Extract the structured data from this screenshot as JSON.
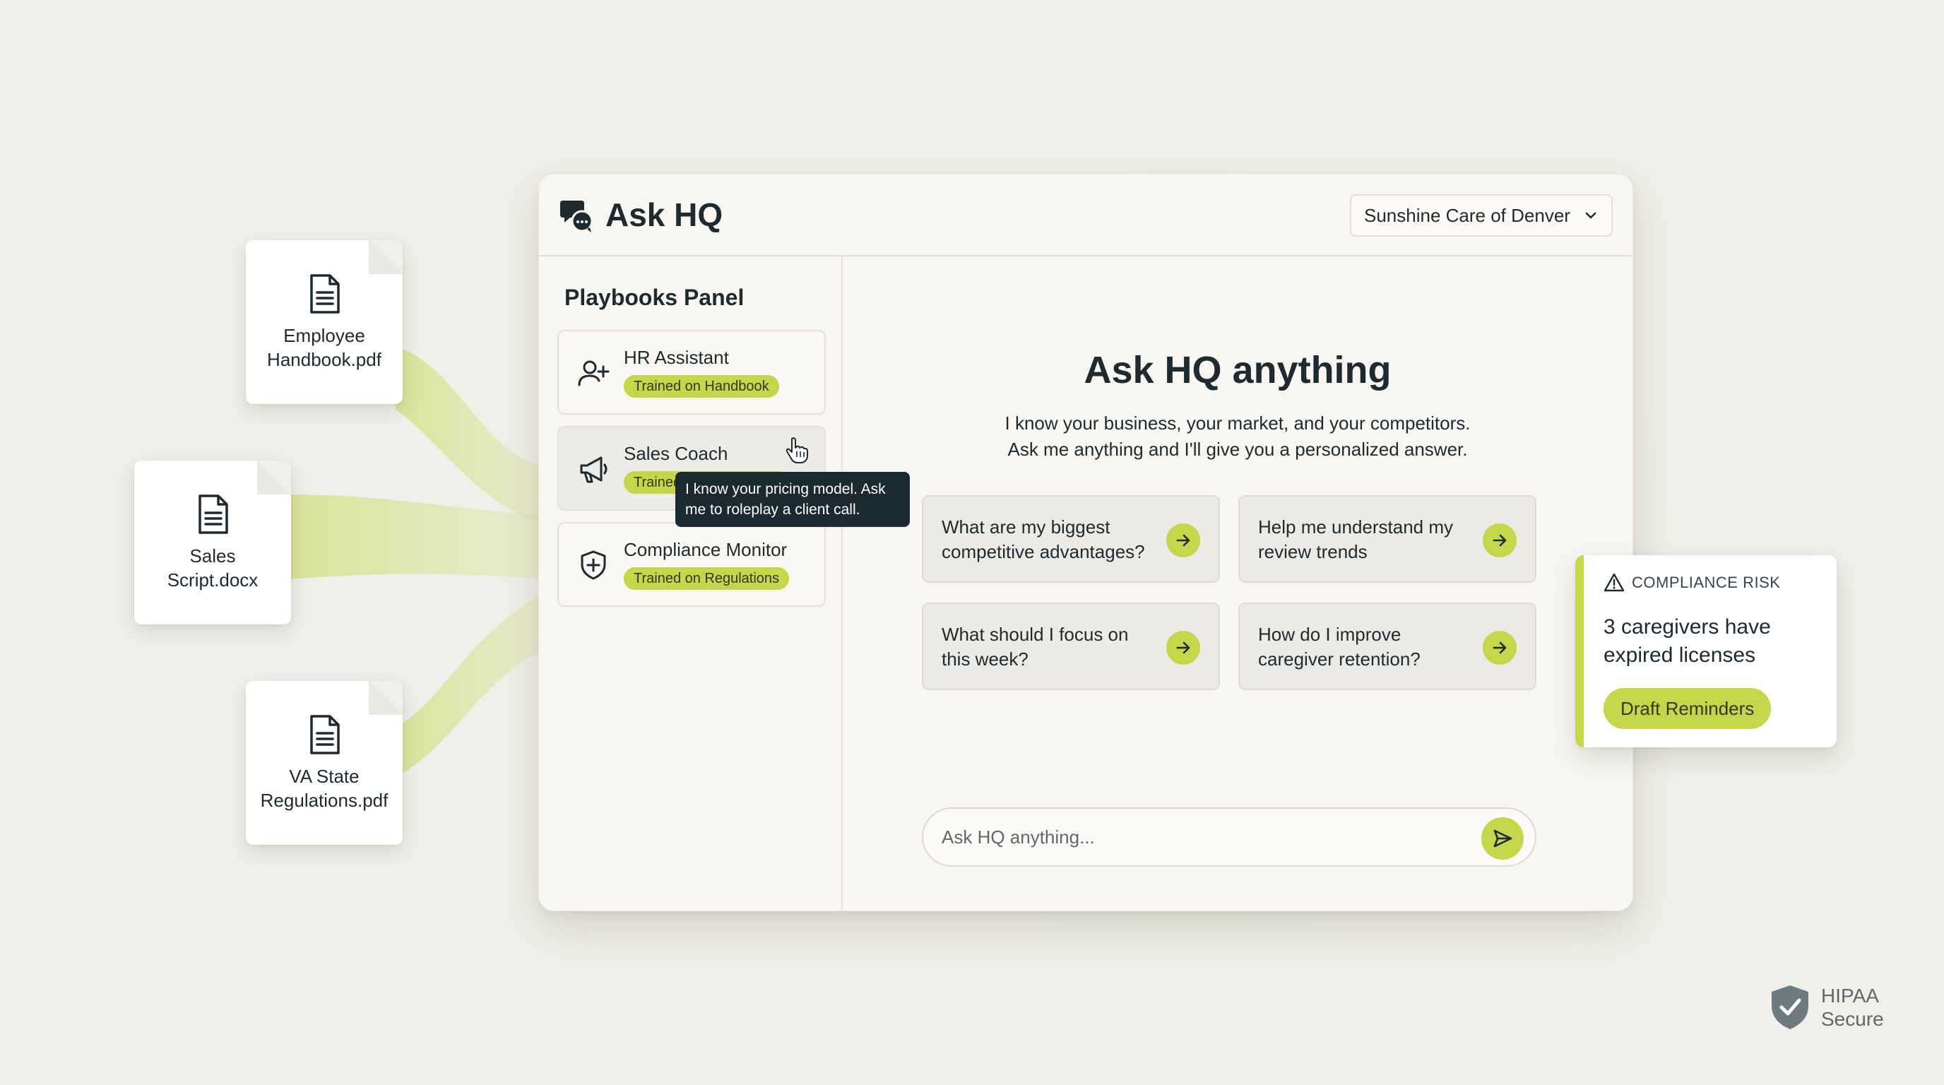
{
  "colors": {
    "accent_lime": "#c5d64b",
    "ink": "#1d2a30",
    "background": "#f0efe9",
    "tooltip_bg": "#1a2a30"
  },
  "documents": [
    {
      "name": "Employee\nHandbook.pdf",
      "icon": "document-icon"
    },
    {
      "name": "Sales\nScript.docx",
      "icon": "document-icon"
    },
    {
      "name": "VA State\nRegulations.pdf",
      "icon": "document-icon"
    }
  ],
  "header": {
    "logo_icon": "chat-bubbles-icon",
    "title": "Ask HQ",
    "location_select": {
      "value": "Sunshine Care of Denver",
      "icon": "chevron-down-icon"
    }
  },
  "sidebar": {
    "title": "Playbooks Panel",
    "playbooks": [
      {
        "name": "HR Assistant",
        "badge": "Trained on Handbook",
        "icon": "user-plus-icon"
      },
      {
        "name": "Sales Coach",
        "badge": "Trained on Sales Script",
        "icon": "megaphone-icon",
        "hovered": true
      },
      {
        "name": "Compliance Monitor",
        "badge": "Trained on Regulations",
        "icon": "shield-plus-icon"
      }
    ],
    "tooltip": {
      "line1": "I know your pricing model. Ask",
      "line2": "me to roleplay a client call."
    },
    "cursor_icon": "hand-pointer-icon"
  },
  "main": {
    "title": "Ask HQ anything",
    "subtitle_line1": "I know your business, your market, and your competitors.",
    "subtitle_line2": "Ask me anything and I'll give you a personalized answer.",
    "prompts": [
      {
        "line1": "What are my biggest",
        "line2": "competitive advantages?"
      },
      {
        "line1": "Help me understand my",
        "line2": "review trends"
      },
      {
        "line1": "What should I focus on",
        "line2": "this week?"
      },
      {
        "line1": "How do I improve",
        "line2": "caregiver retention?"
      }
    ],
    "chat": {
      "placeholder": "Ask HQ anything...",
      "value": "",
      "send_icon": "send-icon"
    }
  },
  "risk_card": {
    "icon": "warning-triangle-icon",
    "label": "COMPLIANCE RISK",
    "message_line1": "3 caregivers have",
    "message_line2": "expired licenses",
    "button": "Draft Reminders"
  },
  "hipaa": {
    "icon": "shield-check-icon",
    "line1": "HIPAA",
    "line2": "Secure"
  }
}
